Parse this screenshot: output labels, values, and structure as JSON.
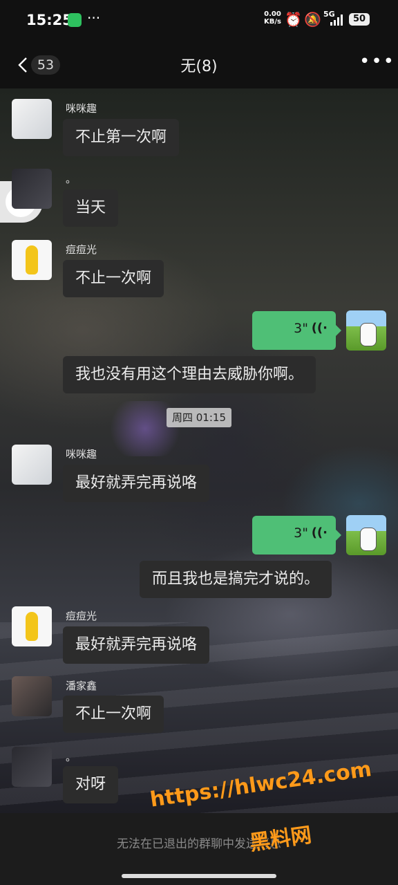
{
  "status_bar": {
    "time": "15:25",
    "net_speed_value": "0.00",
    "net_speed_unit": "KB/s",
    "signal": "5G",
    "battery": "50",
    "more": "···"
  },
  "nav": {
    "back_count": "53",
    "title": "无(8)",
    "more": "•••"
  },
  "messages": [
    {
      "sender": "咪咪趣",
      "text": "不止第一次啊"
    },
    {
      "sender": "。",
      "text": "当天"
    },
    {
      "sender": "痘痘光",
      "text": "不止一次啊"
    },
    {
      "voice_duration": "3\""
    },
    {
      "text": "我也没有用这个理由去威胁你啊。"
    },
    {
      "sender": "咪咪趣",
      "text": "最好就弄完再说咯"
    },
    {
      "voice_duration": "3\""
    },
    {
      "text": "而且我也是搞完才说的。"
    },
    {
      "sender": "痘痘光",
      "text": "最好就弄完再说咯"
    },
    {
      "sender": "潘家鑫",
      "text": "不止一次啊"
    },
    {
      "sender": "。",
      "text": "对呀"
    }
  ],
  "timestamp": "周四 01:15",
  "footer": {
    "notice": "无法在已退出的群聊中发送消息"
  },
  "watermark": {
    "line1": "https://hlwc24.com",
    "line2": "黑料网"
  },
  "colors": {
    "voice_bubble": "#4fbf76",
    "bubble": "#2c2c2c",
    "background": "#1b1b1f"
  },
  "icons": [
    "wechat-icon",
    "alarm-icon",
    "mute-icon",
    "signal-icon",
    "battery-icon",
    "back-icon",
    "more-icon",
    "voice-wave-icon",
    "cube-icon"
  ]
}
